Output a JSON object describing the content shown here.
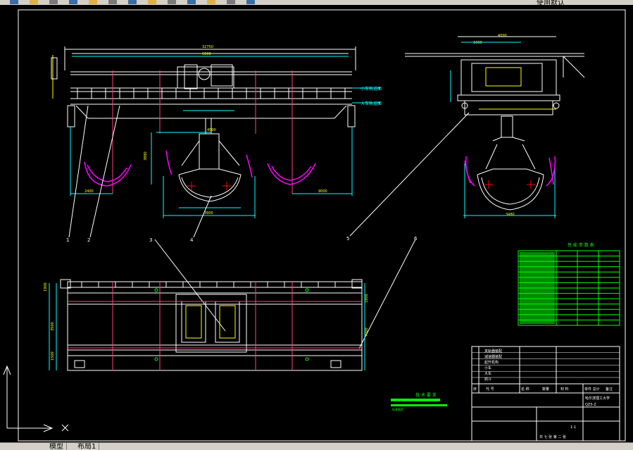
{
  "toolbar": {
    "layer_label": "使用默认",
    "icons": [
      "new-icon",
      "open-icon",
      "save-icon",
      "print-icon",
      "cut-icon",
      "copy-icon",
      "paste-icon",
      "undo-icon",
      "redo-icon",
      "pan-icon",
      "zoom-icon",
      "properties-icon",
      "layer-icon"
    ]
  },
  "tabs": {
    "model": "模型",
    "layout1": "布局1"
  },
  "drawing": {
    "main_span": "32750",
    "sub_span": "6000",
    "right_top_dim": "4000",
    "right_top_small": "1000",
    "label_trolley_track": "小车轨道面",
    "label_crane_track": "大车轨道面",
    "right_mid_dim": "9000",
    "left_dim": "2400",
    "bucket_h": "3880",
    "bucket_w": "3900",
    "bucket_w2": "4500",
    "right_bucket_w": "3480",
    "callouts": [
      "1",
      "2",
      "3",
      "4",
      "5",
      "6"
    ],
    "plan_dims": [
      "1900",
      "3500",
      "1500",
      "1800",
      "7000"
    ],
    "param_table_title": "性 能 参 数 表",
    "tech_req_title": "技 术 要 求",
    "tech_req_line": "按GB/T14406-93",
    "tech_req_line2": "标准制造",
    "title_block": {
      "headers": [
        "序",
        "代 号",
        "名 称",
        "数量",
        "材 料",
        "单件 总计",
        "备注"
      ],
      "school": "哈尔滨理工大学",
      "drawing_no": "QZ5-Z",
      "scale": "1:1",
      "sheet": "共 七 张  第 二 张",
      "items": [
        "夹轨器装配",
        "减速器装配",
        "起升机构",
        "小车",
        "大车",
        "抓斗"
      ]
    }
  }
}
